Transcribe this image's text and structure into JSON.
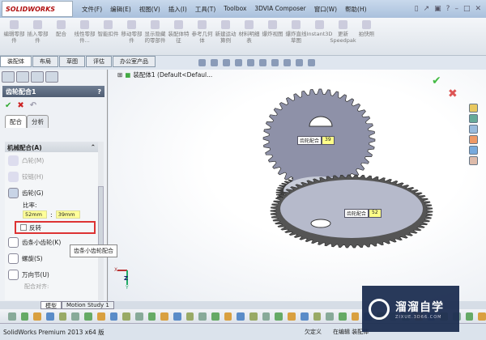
{
  "app": {
    "logo": "SOLIDWORKS"
  },
  "menu": [
    "文件(F)",
    "编辑(E)",
    "视图(V)",
    "插入(I)",
    "工具(T)",
    "Toolbox",
    "3DVIA Composer",
    "窗口(W)",
    "帮助(H)"
  ],
  "ribbon": [
    "编辑零部件",
    "插入零部件",
    "配合",
    "线性零部件...",
    "智能扣件",
    "移动零部件",
    "显示隐藏的零部件",
    "装配体特征",
    "参考几何体",
    "新建运动算例",
    "材料明细表",
    "爆炸视图",
    "爆炸直线草图",
    "Instant3D",
    "更新Speedpak",
    "拍快照"
  ],
  "tabs": [
    "装配体",
    "布局",
    "草图",
    "评估",
    "办公室产品"
  ],
  "tree": {
    "root": "装配体1 (Default<Defaul..."
  },
  "property_manager": {
    "title": "齿轮配合1",
    "help": "?",
    "subtabs": [
      "配合",
      "分析"
    ],
    "group_title": "机械配合(A)",
    "mates": [
      "凸轮(M)",
      "铰链(H)",
      "齿轮(G)"
    ],
    "ratio_label": "比率:",
    "ratio_a": "52mm",
    "ratio_sep": ":",
    "ratio_b": "39mm",
    "reverse": "反转",
    "mates2": [
      "齿条小齿轮(K)",
      "螺旋(S)",
      "万向节(U)"
    ],
    "align_label": "配合对齐:"
  },
  "tooltip": "齿条小齿轮配合",
  "dims": {
    "top_label": "齿轮配合",
    "top_value": "39",
    "bottom_label": "齿轮配合",
    "bottom_value": "52"
  },
  "triad": {
    "x": "X",
    "y": "Y",
    "z": "Z"
  },
  "bottom_tabs": [
    "模型",
    "Motion Study 1"
  ],
  "status": {
    "left": "SolidWorks Premium 2013 x64 版",
    "defined": "欠定义",
    "editing": "在编辑 装配体"
  },
  "watermark": {
    "name": "溜溜自学",
    "url": "ZIXUE.3D66.COM"
  }
}
